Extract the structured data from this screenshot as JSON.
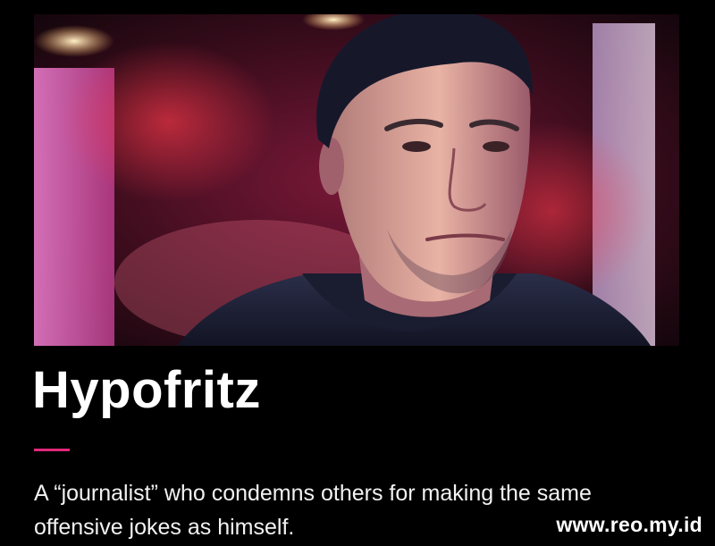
{
  "profile": {
    "name": "Hypofritz",
    "description": "A “journalist” who condemns others for making the same offensive jokes as himself."
  },
  "watermark": "www.reo.my.id",
  "colors": {
    "background": "#000000",
    "accent": "#e0287a",
    "text": "#ffffff"
  },
  "photo": {
    "subject": "portrait-of-man"
  }
}
